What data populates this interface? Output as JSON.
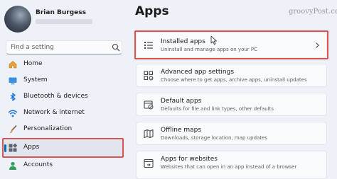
{
  "user": {
    "name": "Brian Burgess"
  },
  "search": {
    "placeholder": "Find a setting"
  },
  "sidebar": {
    "items": [
      {
        "label": "Home",
        "icon": "home-icon"
      },
      {
        "label": "System",
        "icon": "system-icon"
      },
      {
        "label": "Bluetooth & devices",
        "icon": "bluetooth-icon"
      },
      {
        "label": "Network & internet",
        "icon": "wifi-icon"
      },
      {
        "label": "Personalization",
        "icon": "brush-icon"
      },
      {
        "label": "Apps",
        "icon": "apps-icon",
        "selected": true
      },
      {
        "label": "Accounts",
        "icon": "account-icon"
      }
    ]
  },
  "main": {
    "title": "Apps",
    "watermark": "groovyPost.com",
    "cards": [
      {
        "title": "Installed apps",
        "subtitle": "Uninstall and manage apps on your PC",
        "icon": "installed-apps-icon",
        "highlighted": true
      },
      {
        "title": "Advanced app settings",
        "subtitle": "Choose where to get apps, archive apps, uninstall updates",
        "icon": "advanced-settings-icon"
      },
      {
        "title": "Default apps",
        "subtitle": "Defaults for file and link types, other defaults",
        "icon": "default-apps-icon"
      },
      {
        "title": "Offline maps",
        "subtitle": "Downloads, storage location, map updates",
        "icon": "map-icon"
      },
      {
        "title": "Apps for websites",
        "subtitle": "Websites that can open in an app instead of a browser",
        "icon": "website-apps-icon"
      }
    ]
  },
  "colors": {
    "accent": "#0067c0",
    "highlight_box": "#d9534f",
    "background": "#eef2f8",
    "card": "#f9fafc"
  }
}
